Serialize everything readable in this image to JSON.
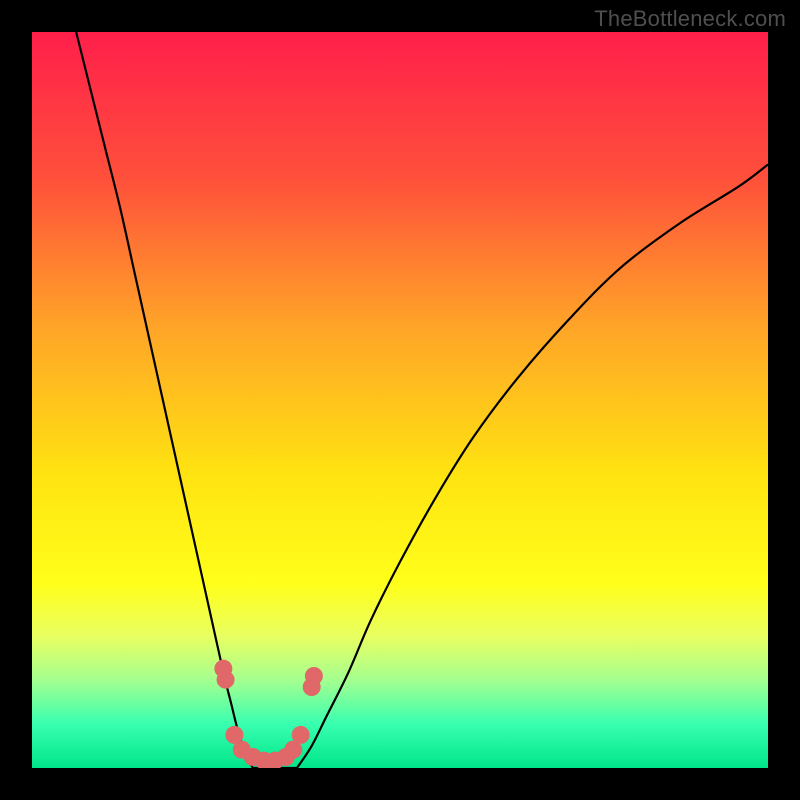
{
  "watermark": "TheBottleneck.com",
  "chart_data": {
    "type": "line",
    "title": "",
    "xlabel": "",
    "ylabel": "",
    "xlim": [
      0,
      100
    ],
    "ylim": [
      0,
      100
    ],
    "background_gradient": {
      "stops": [
        {
          "pos": 0.0,
          "color": "#ff1f4b"
        },
        {
          "pos": 0.2,
          "color": "#ff503b"
        },
        {
          "pos": 0.4,
          "color": "#ffa428"
        },
        {
          "pos": 0.6,
          "color": "#ffe311"
        },
        {
          "pos": 0.75,
          "color": "#ffff1a"
        },
        {
          "pos": 0.82,
          "color": "#e9ff60"
        },
        {
          "pos": 0.88,
          "color": "#a5ff8f"
        },
        {
          "pos": 0.94,
          "color": "#39ffb0"
        },
        {
          "pos": 1.0,
          "color": "#00e58a"
        }
      ]
    },
    "series": [
      {
        "name": "left-curve",
        "x": [
          6,
          8,
          10,
          12,
          14,
          16,
          18,
          20,
          22,
          24,
          26,
          27,
          28,
          29,
          30
        ],
        "y": [
          100,
          92,
          84,
          76,
          67,
          58,
          49,
          40,
          31,
          22,
          13,
          9,
          5,
          2,
          0
        ]
      },
      {
        "name": "right-curve",
        "x": [
          36,
          38,
          40,
          43,
          46,
          50,
          55,
          60,
          66,
          73,
          80,
          88,
          96,
          100
        ],
        "y": [
          0,
          3,
          7,
          13,
          20,
          28,
          37,
          45,
          53,
          61,
          68,
          74,
          79,
          82
        ]
      },
      {
        "name": "bottom-flat",
        "x": [
          30,
          31,
          32,
          33,
          34,
          35,
          36
        ],
        "y": [
          0,
          0,
          0,
          0,
          0,
          0,
          0
        ]
      }
    ],
    "markers": {
      "name": "highlight-dots",
      "color": "#e06868",
      "points": [
        {
          "x": 26.0,
          "y": 13.5
        },
        {
          "x": 26.3,
          "y": 12.0
        },
        {
          "x": 27.5,
          "y": 4.5
        },
        {
          "x": 28.5,
          "y": 2.5
        },
        {
          "x": 30.0,
          "y": 1.5
        },
        {
          "x": 31.5,
          "y": 1.0
        },
        {
          "x": 33.0,
          "y": 1.0
        },
        {
          "x": 34.5,
          "y": 1.5
        },
        {
          "x": 35.5,
          "y": 2.5
        },
        {
          "x": 36.5,
          "y": 4.5
        },
        {
          "x": 38.0,
          "y": 11.0
        },
        {
          "x": 38.3,
          "y": 12.5
        }
      ]
    }
  }
}
